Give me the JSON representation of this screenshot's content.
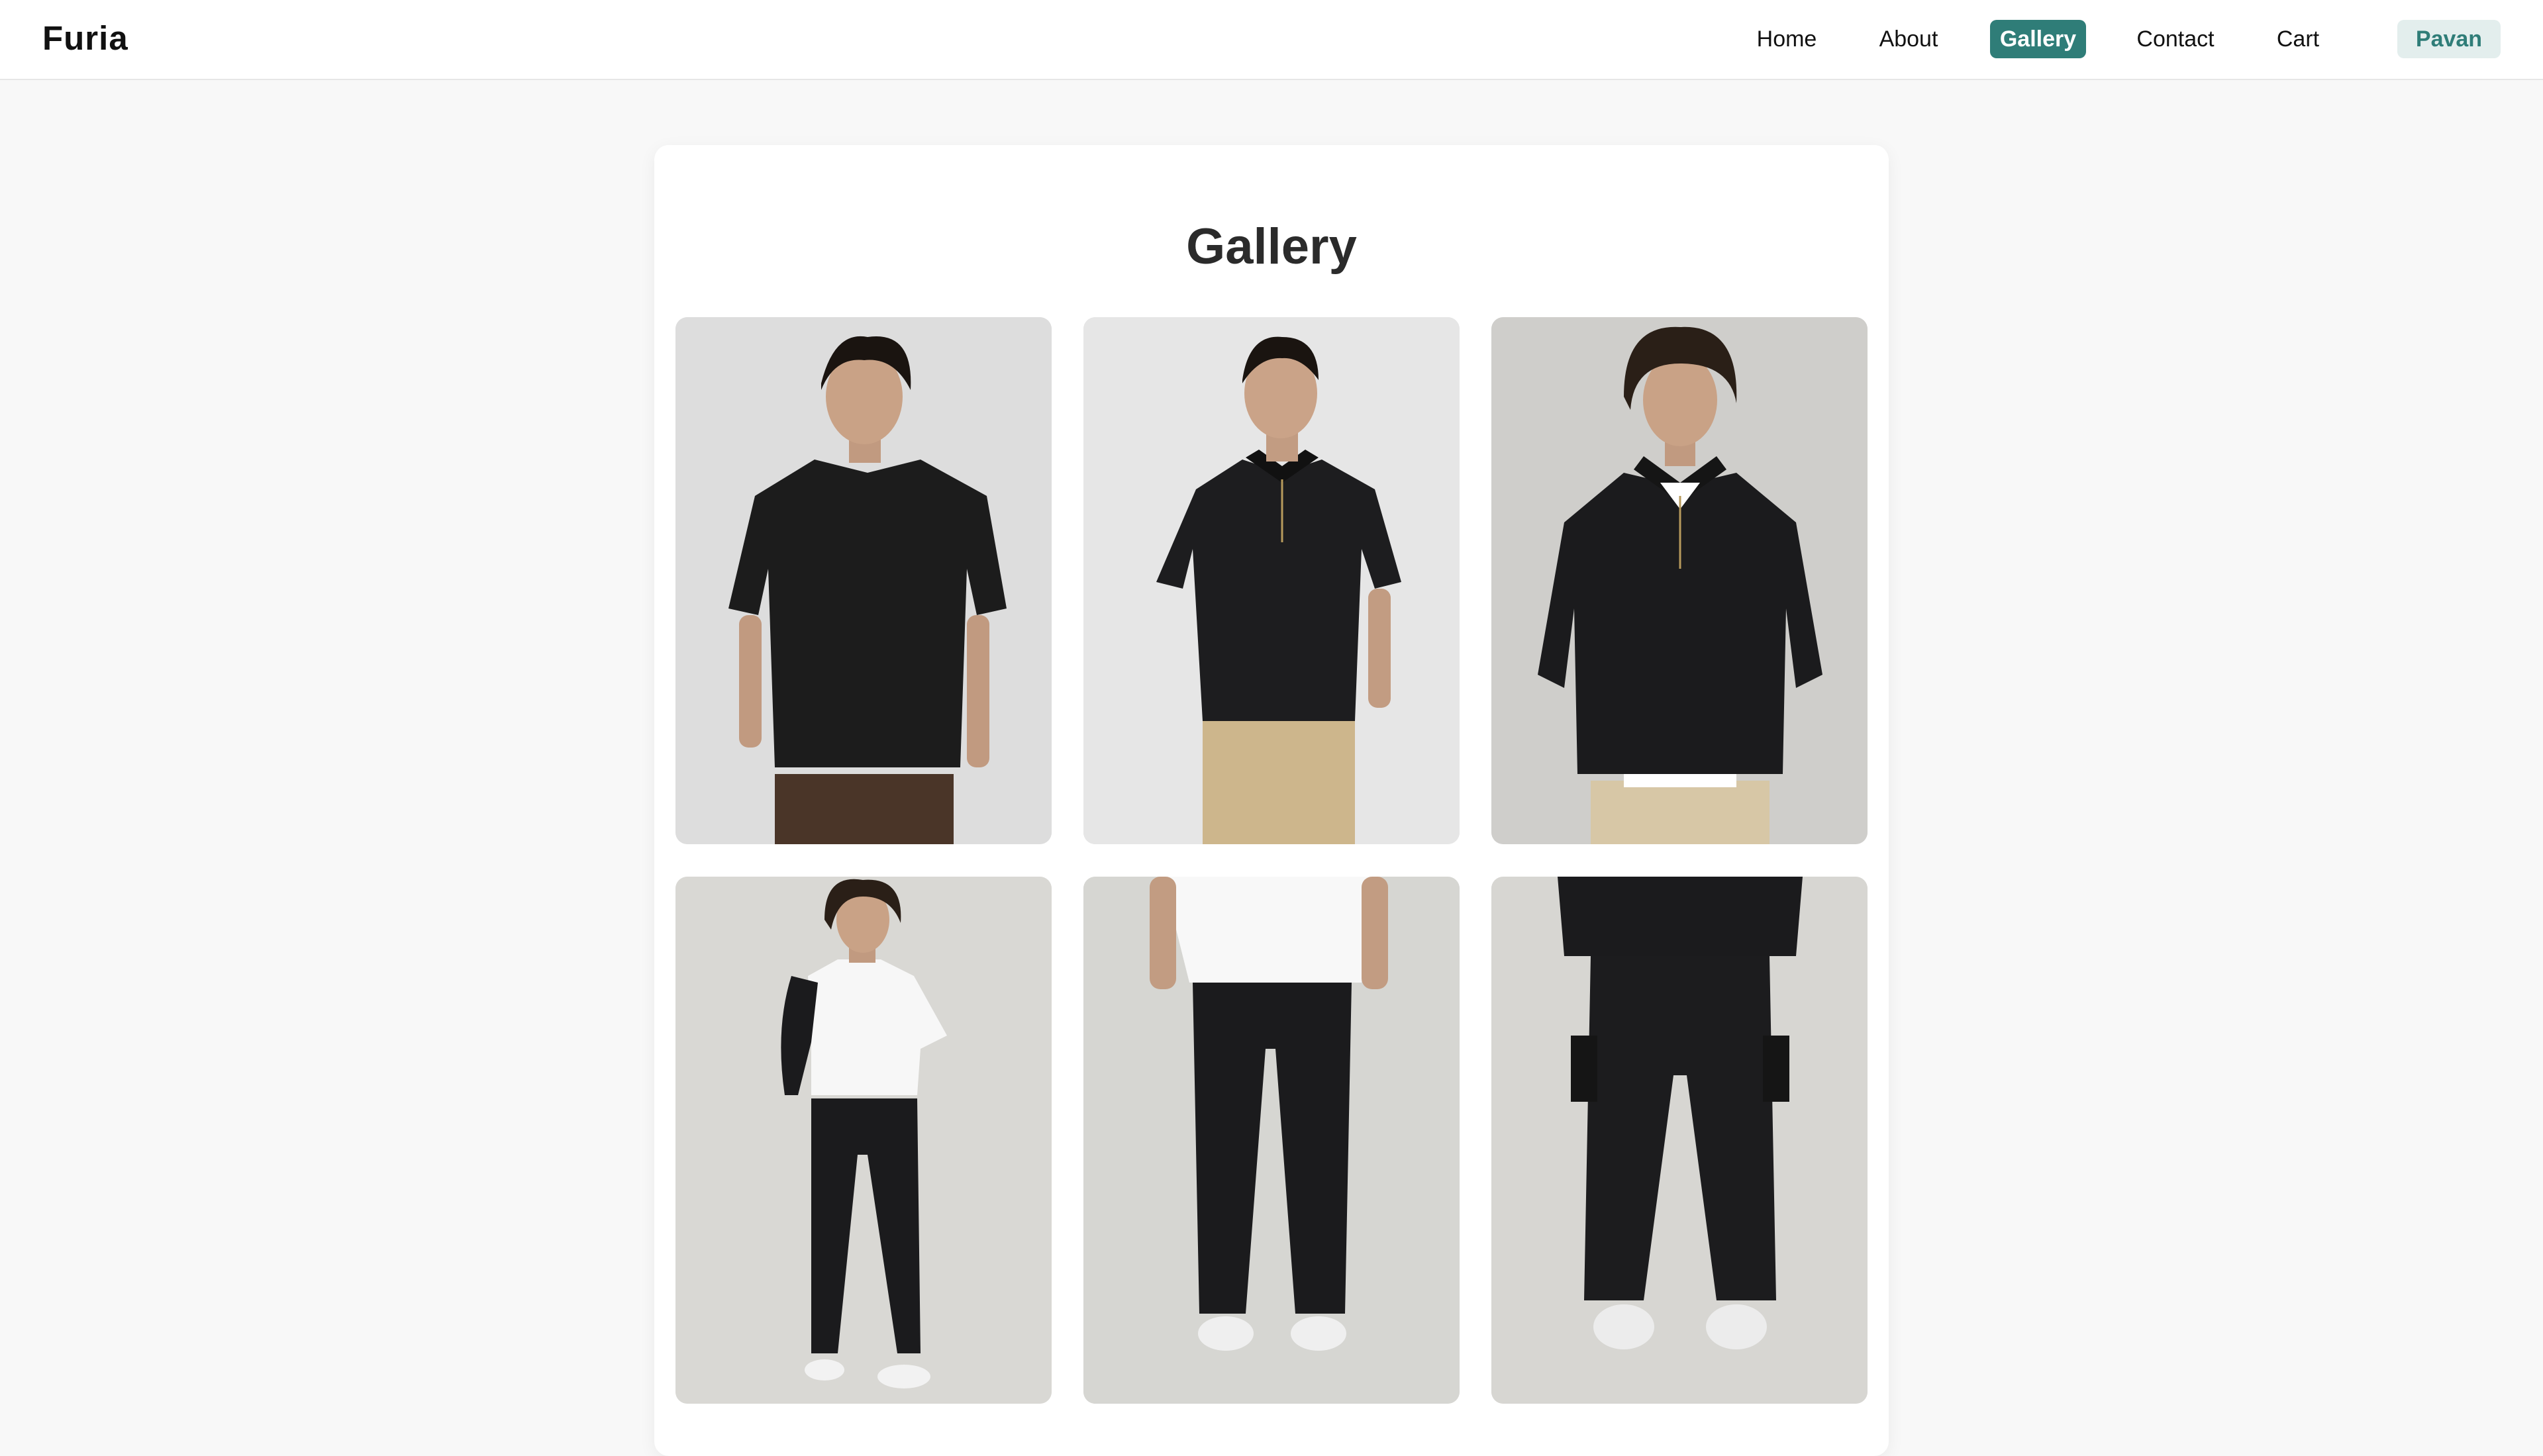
{
  "brand": "Furia",
  "nav": {
    "items": [
      {
        "label": "Home"
      },
      {
        "label": "About"
      },
      {
        "label": "Gallery",
        "active": true
      },
      {
        "label": "Contact"
      },
      {
        "label": "Cart"
      }
    ],
    "user": "Pavan"
  },
  "page": {
    "title": "Gallery"
  },
  "gallery": {
    "images": [
      {
        "icon": "model-black-tshirt-brown-pants-photo"
      },
      {
        "icon": "model-black-polo-beige-pants-photo"
      },
      {
        "icon": "model-black-quarter-zip-photo"
      },
      {
        "icon": "model-white-tshirt-black-pants-photo"
      },
      {
        "icon": "black-trousers-closeup-photo"
      },
      {
        "icon": "black-cargo-joggers-photo"
      }
    ]
  },
  "colors": {
    "accent": "#2f7d78",
    "accent_light": "#e3eeed",
    "background": "#f8f8f8"
  }
}
